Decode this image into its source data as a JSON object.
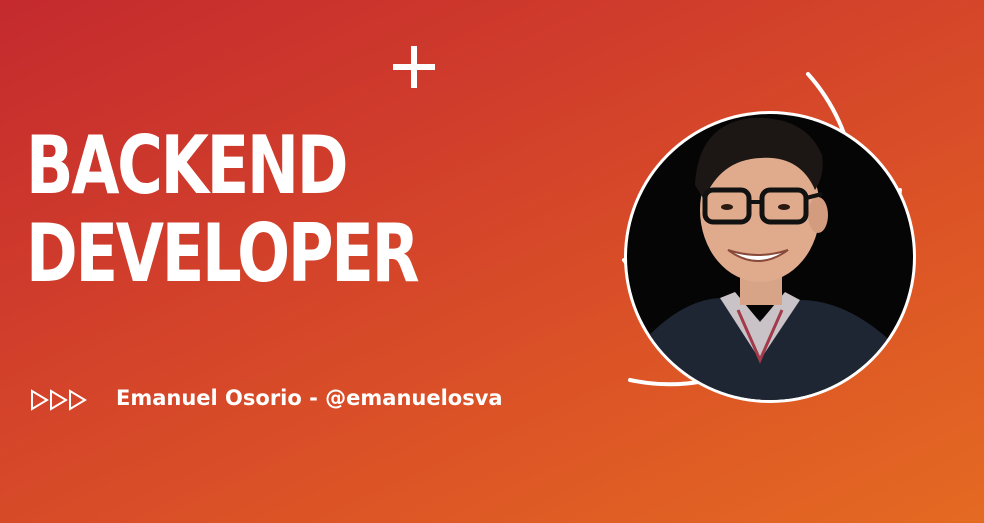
{
  "headline": {
    "line1": "BACKEND",
    "line2": "DEVELOPER"
  },
  "author": {
    "text": "Emanuel Osorio - @emanuelosva"
  },
  "icons": {
    "plus": "plus-icon",
    "arrows": "triple-play-arrows-icon",
    "avatar": "person-avatar"
  },
  "colors": {
    "gradient_start": "#c42a2e",
    "gradient_end": "#e46a22",
    "text": "#ffffff",
    "photo_background": "#050505"
  }
}
